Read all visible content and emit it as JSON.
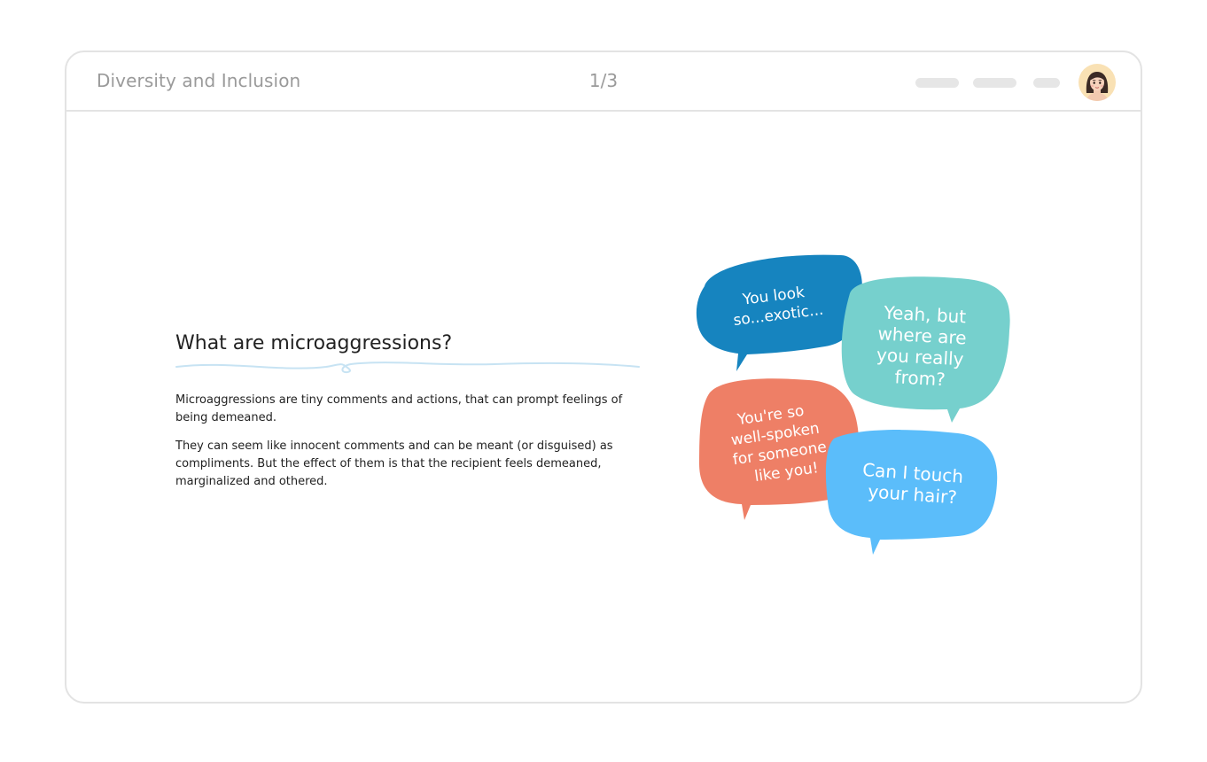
{
  "header": {
    "title": "Diversity and Inclusion",
    "page_counter": "1/3",
    "avatar_icon": "woman-avatar-icon"
  },
  "main": {
    "heading": "What are microaggressions?",
    "paragraphs": [
      "Microaggressions are tiny comments and actions, that can prompt feelings of being demeaned.",
      "They can seem like innocent comments and can be meant (or disguised) as compliments. But the effect of them is that the recipient feels demeaned, marginalized and othered."
    ]
  },
  "illustration": {
    "bubbles": [
      {
        "lines": [
          "You look",
          "so...exotic..."
        ],
        "color": "#1684bf"
      },
      {
        "lines": [
          "Yeah, but",
          "where are",
          "you really",
          "from?"
        ],
        "color": "#76d0cd"
      },
      {
        "lines": [
          "You're so",
          "well-spoken",
          "for someone",
          "like you!"
        ],
        "color": "#ee7f66"
      },
      {
        "lines": [
          "Can I touch",
          "your hair?"
        ],
        "color": "#5bbdfa"
      }
    ]
  },
  "colors": {
    "frame_border": "#e3e3e3",
    "muted_text": "#9a9a9a",
    "wave": "#c7e3f3",
    "avatar_bg": "#f9e1b4"
  }
}
